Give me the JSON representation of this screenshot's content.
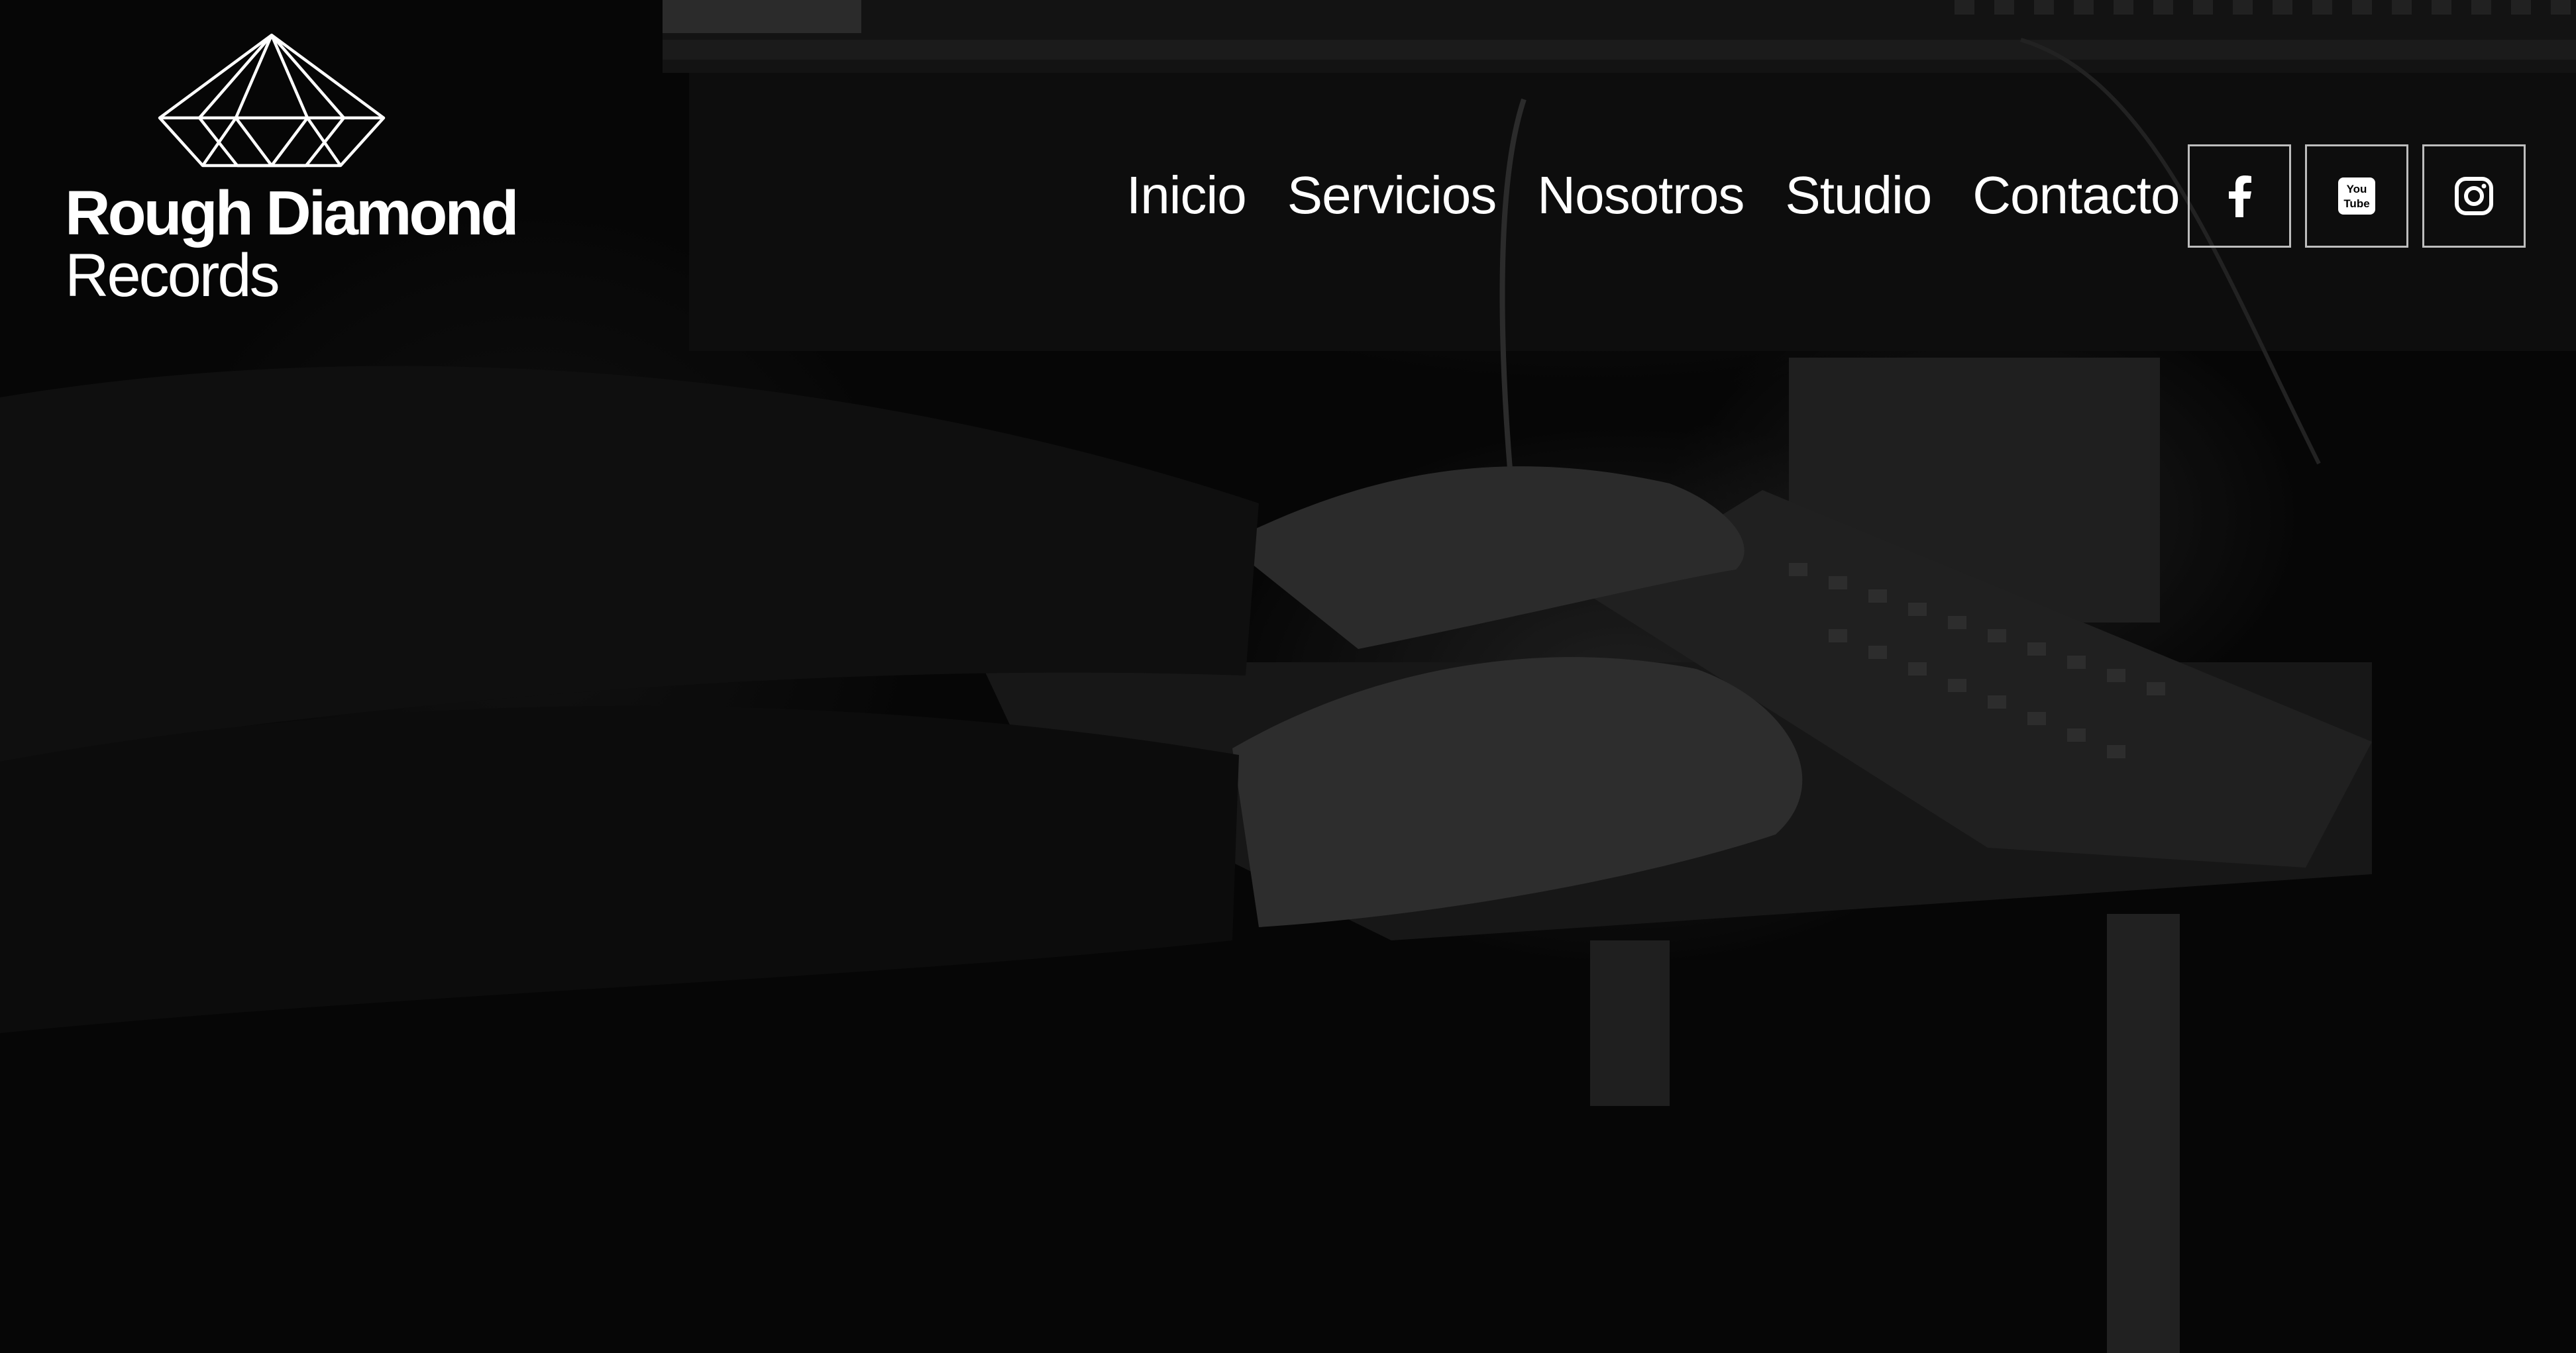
{
  "brand": {
    "name_line1": "Rough Diamond",
    "name_line2": "Records",
    "logo_icon": "diamond-pyramid-icon",
    "color": "#ffffff"
  },
  "nav": {
    "items": [
      {
        "label": "Inicio"
      },
      {
        "label": "Servicios"
      },
      {
        "label": "Nosotros"
      },
      {
        "label": "Studio"
      },
      {
        "label": "Contacto"
      }
    ]
  },
  "social": {
    "icons": [
      "facebook-icon",
      "youtube-icon",
      "instagram-icon"
    ],
    "youtube_icon_text_top": "You",
    "youtube_icon_text_bottom": "Tube"
  },
  "theme": {
    "background": "#080808",
    "text": "#ffffff",
    "border": "#bdbdbd"
  }
}
